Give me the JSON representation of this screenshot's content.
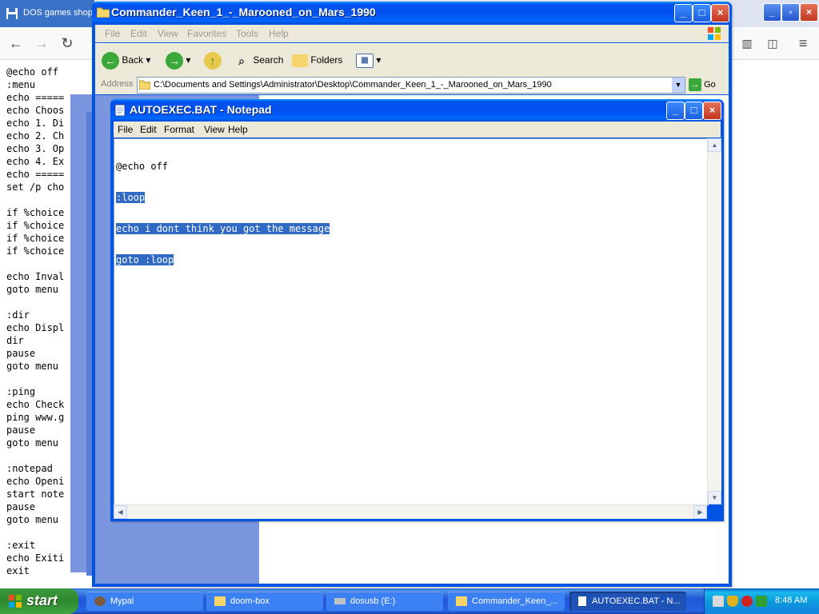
{
  "browser": {
    "tab_title": "DOS games shop",
    "code_lines": [
      "@echo off",
      ":menu",
      "echo =====",
      "echo Choos",
      "echo 1. Di",
      "echo 2. Ch",
      "echo 3. Op",
      "echo 4. Ex",
      "echo =====",
      "set /p cho",
      "",
      "if %choice",
      "if %choice",
      "if %choice",
      "if %choice",
      "",
      "echo Inval",
      "goto menu",
      "",
      ":dir",
      "echo Displ",
      "dir",
      "pause",
      "goto menu",
      "",
      ":ping",
      "echo Check",
      "ping www.g",
      "pause",
      "goto menu",
      "",
      ":notepad",
      "echo Openi",
      "start note",
      "pause",
      "goto menu",
      "",
      ":exit",
      "echo Exiti",
      "exit"
    ]
  },
  "explorer": {
    "title": "Commander_Keen_1_-_Marooned_on_Mars_1990",
    "menu": [
      "File",
      "Edit",
      "View",
      "Favorites",
      "Tools",
      "Help"
    ],
    "toolbar": {
      "back": "Back",
      "search": "Search",
      "folders": "Folders"
    },
    "address_label": "Address",
    "address_value": "C:\\Documents and Settings\\Administrator\\Desktop\\Commander_Keen_1_-_Marooned_on_Mars_1990",
    "go": "Go"
  },
  "notepad": {
    "title": "AUTOEXEC.BAT - Notepad",
    "menu": [
      "File",
      "Edit",
      "Format",
      "View",
      "Help"
    ],
    "lines": [
      "@echo off",
      ":loop",
      "echo i dont think you got the message",
      "goto :loop"
    ]
  },
  "taskbar": {
    "start": "start",
    "tasks": [
      "Mypal",
      "doom-box",
      "dosusb (E:)",
      "Commander_Keen_...",
      "AUTOEXEC.BAT - N..."
    ],
    "clock": "8:48 AM"
  },
  "colors": {
    "xp_blue": "#0054e3",
    "selection": "#316ac5",
    "start_green": "#3c9a3c"
  }
}
